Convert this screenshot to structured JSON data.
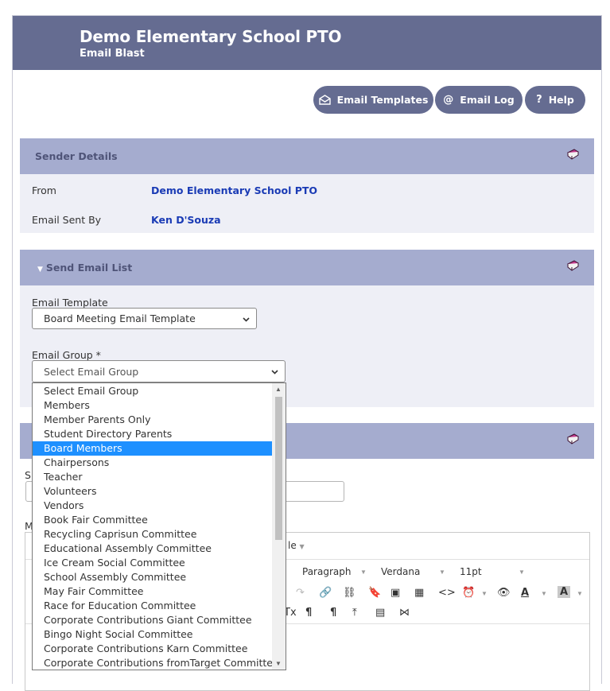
{
  "header": {
    "title": "Demo Elementary School PTO",
    "subtitle": "Email Blast"
  },
  "actions": {
    "email_templates": "Email Templates",
    "email_log": "Email Log",
    "help": "Help"
  },
  "sender_details": {
    "heading": "Sender Details",
    "from_label": "From",
    "from_value": "Demo Elementary School PTO",
    "sent_by_label": "Email Sent By",
    "sent_by_value": "Ken D'Souza"
  },
  "send_email_list": {
    "heading": "Send Email List",
    "template_label": "Email Template",
    "template_value": "Board Meeting Email Template",
    "group_label": "Email Group *",
    "group_value": "Select Email Group"
  },
  "group_options": [
    "Select Email Group",
    "Members",
    "Member Parents Only",
    "Student Directory Parents",
    "Board Members",
    "Chairpersons",
    "Teacher",
    "Volunteers",
    "Vendors",
    "Book Fair Committee",
    "Recycling Caprisun Committee",
    "Educational Assembly Committee",
    "Ice Cream Social Committee",
    "School Assembly Committee",
    "May Fair Committee",
    "Race for Education Committee",
    "Corporate Contributions Giant Committee",
    "Bingo Night Social Committee",
    "Corporate Contributions Karn Committee",
    "Corporate Contributions fromTarget Committee"
  ],
  "selected_option_index": 4,
  "partial": {
    "subject_label_fragment": "S",
    "message_label_fragment": "M",
    "menu_fragment": "le"
  },
  "editor_toolbar": {
    "format": "Paragraph",
    "font": "Verdana",
    "size": "11pt"
  },
  "colors": {
    "header_bg": "#656c91",
    "panel_head_bg": "#a5accf",
    "panel_body_bg": "#eeeff6",
    "link_blue": "#1a3bb5",
    "selected_option": "#1e90ff"
  }
}
